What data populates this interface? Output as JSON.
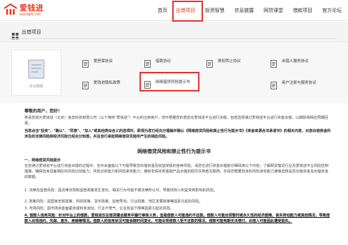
{
  "header": {
    "logo_cn": "爱钱进",
    "logo_en": "AIQIANJIN.COM",
    "nav": [
      "首页",
      "出借项目",
      "投资智慧",
      "信息披露",
      "网贷课堂",
      "借款项目",
      "官方论坛"
    ],
    "active_index": 1
  },
  "band": {
    "title": "出借项目"
  },
  "panel": {
    "side_label": "协议模板",
    "docs": [
      "爱担保协议",
      "借款协议",
      "债权转让协议",
      "出借人服务协议",
      "用户注册与服务协议",
      "爱钱进隐私政策",
      "网络借贷风险提示书"
    ]
  },
  "content": {
    "greet": "尊敬的用户，您好！",
    "intro": "恭喜您成为爱钱进（北京）信息科技有限公司（以下简称\"爱钱进\"）平台的注册用户。您可根据您的意愿在爱钱进平台进行出借，自愿选择通过爱钱进平台进行资金出借，以期获得相应预期回报。",
    "para1": "当您点击\"投资\"、\"确认\"、\"同意\"、\"加入\"或其他类似含义的选项时，即视为您已经充分理解并确认《网络借贷风险和禁止性行为提示书》《资金来源合法承诺书》的相关内容，对您出借资金所涉及的法律风险和经济风险已经充分知悉，并且自行承担网络借贷风险所产生的相应风险。",
    "title": "网络借贷风险和禁止性行为提示书",
    "s1": "一、网络借贷风险提示",
    "p1": "在您通过爱钱进平台进行资金出借的过程中，也许会面临以下可能导致您出借资金及收益受损的各种风险。请您在进行资金出借前仔细阅读以下内容，了解网贷借贷行业及爱钱进平台风险控制措施，确保自身具备相应的风险识别能力，风险识别能力和风险承受能力，拥有非保本类金融产品出借的经历并熟悉互联网，并请您根据自身的风险承受能力谨慎选择是否出借资金及出借资金的数额。",
    "l1": "1. 法律及监管风险：因法律法规和监管政策发生变化，相关行为可能不被法律所认可，导致债权人利益受到影响的风险。",
    "l2": "2. 政策风险：因国家宏观政策、财政政策、货币政策、监管导向、行业政策、地区发展政策等因素引起的风险。",
    "l3": "3. 市场风险：因市场资金面紧张或利率波动、行业不景气、企业效益下降等因素引起的风险。",
    "l4": "4. 借款人信用风险：针对平台上的借款，爱钱进仅在借贷撮合服务中履行审核义务，但是借款人可能违约不还款。借款人可能出现暂时或永久性的经济困难、丧失劳动能力或其他情况，导致借款人出现违约、失踪、意外、疾病等情况。借款人的信用状况可能会随时间变化，可能出现借款人拒不还款的情况，借款可能到期无法偿付，出借人可能因此遭受损失。"
  }
}
